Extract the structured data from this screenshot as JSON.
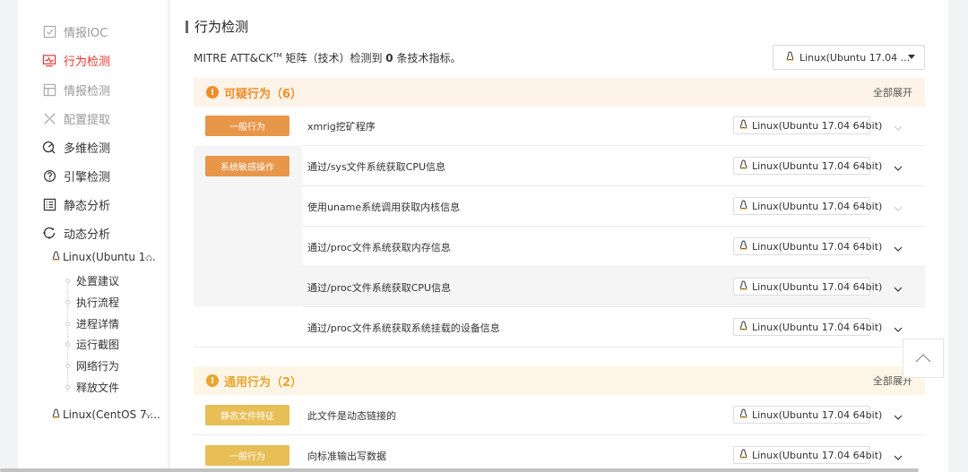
{
  "sidebar": {
    "items": [
      {
        "label": "情报IOC",
        "icon": "checklist-icon",
        "state": "muted"
      },
      {
        "label": "行为检测",
        "icon": "monitor-pulse-icon",
        "state": "active"
      },
      {
        "label": "情报检测",
        "icon": "layout-icon",
        "state": "muted"
      },
      {
        "label": "配置提取",
        "icon": "tools-icon",
        "state": "muted"
      },
      {
        "label": "多维检测",
        "icon": "radar-icon",
        "state": "normal"
      },
      {
        "label": "引擎检测",
        "icon": "engine-icon",
        "state": "normal"
      },
      {
        "label": "静态分析",
        "icon": "list-doc-icon",
        "state": "normal"
      },
      {
        "label": "动态分析",
        "icon": "refresh-icon",
        "state": "normal"
      }
    ],
    "env1": "Linux(Ubuntu 1...",
    "env2": "Linux(CentOS 7....",
    "tree": [
      "处置建议",
      "执行流程",
      "进程详情",
      "运行截图",
      "网络行为",
      "释放文件"
    ]
  },
  "main": {
    "title": "行为检测",
    "summary_prefix": "MITRE ATT&CK",
    "summary_tm": "TM",
    "summary_mid": " 矩阵（技术）检测到 ",
    "summary_count": "0",
    "summary_suffix": " 条技术指标。",
    "os_select_value": "Linux(Ubuntu 17.04 ...",
    "sections": [
      {
        "title": "可疑行为（6）",
        "expand_label": "全部展开",
        "color": "#f08c28",
        "bg": "#fdf3e8"
      },
      {
        "title": "通用行为（2）",
        "expand_label": "全部展开",
        "color": "#e8a530",
        "bg": "#fdf6e6"
      }
    ],
    "rows": [
      {
        "tag": "一般行为",
        "behavior": "xmrig挖矿程序",
        "os": "Linux(Ubuntu 17.04 64bit)",
        "chevron": "light"
      },
      {
        "tag": "系统敏感操作",
        "behavior": "通过/sys文件系统获取CPU信息",
        "os": "Linux(Ubuntu 17.04 64bit)",
        "chevron": "dark"
      },
      {
        "tag": "",
        "behavior": "使用uname系统调用获取内核信息",
        "os": "Linux(Ubuntu 17.04 64bit)",
        "chevron": "light"
      },
      {
        "tag": "",
        "behavior": "通过/proc文件系统获取内存信息",
        "os": "Linux(Ubuntu 17.04 64bit)",
        "chevron": "dark"
      },
      {
        "tag": "",
        "behavior": "通过/proc文件系统获取CPU信息",
        "os": "Linux(Ubuntu 17.04 64bit)",
        "chevron": "dark"
      },
      {
        "tag": "",
        "behavior": "通过/proc文件系统获取系统挂载的设备信息",
        "os": "Linux(Ubuntu 17.04 64bit)",
        "chevron": "dark"
      },
      {
        "tag": "静态文件特征",
        "behavior": "此文件是动态链接的",
        "os": "Linux(Ubuntu 17.04 64bit)",
        "chevron": "dark"
      },
      {
        "tag": "一般行为",
        "behavior": "向标准输出写数据",
        "os": "Linux(Ubuntu 17.04 64bit)",
        "chevron": "dark"
      }
    ],
    "tag_colors": {
      "orange": "#e8964a",
      "yellow": "#e8be56"
    }
  }
}
